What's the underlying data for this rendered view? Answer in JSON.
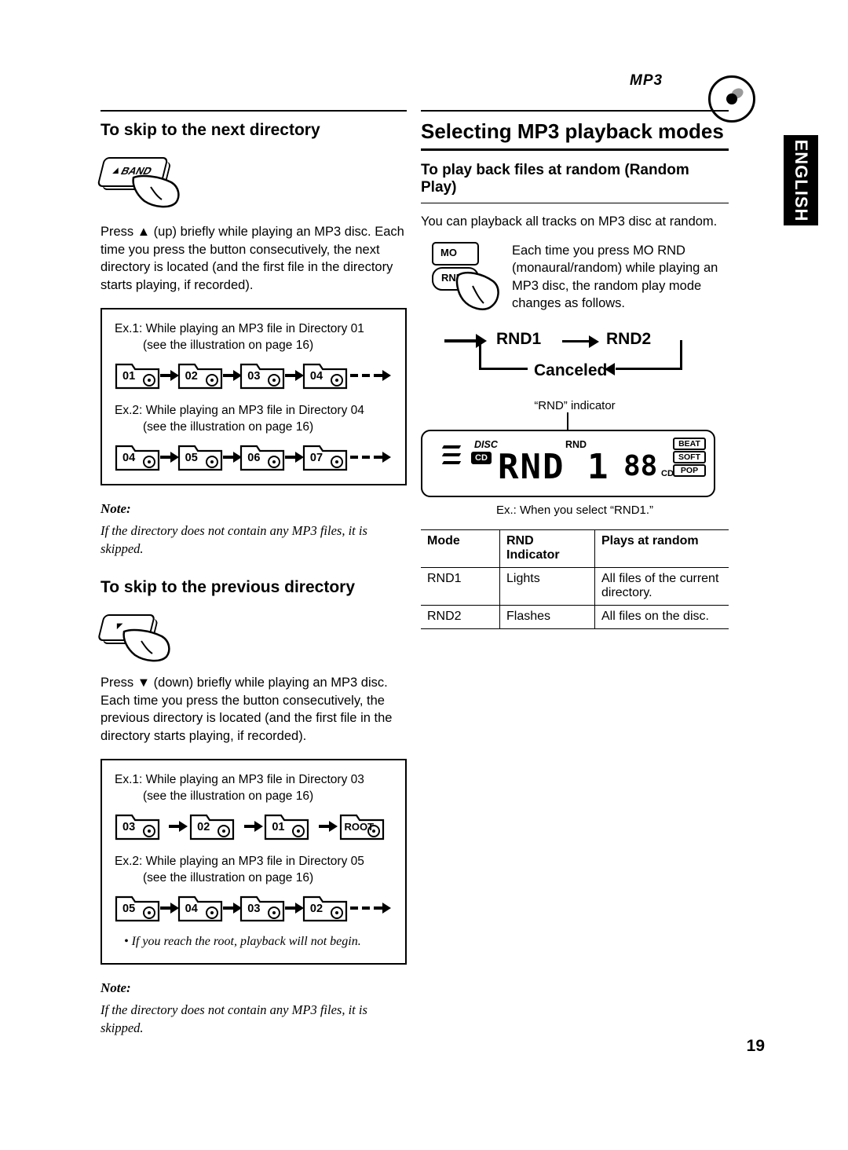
{
  "page": {
    "number": "19",
    "side_tab": "ENGLISH",
    "logo_text": "MP3"
  },
  "left": {
    "heading1": "To skip to the next directory",
    "button1_label": "BAND",
    "paragraph1": "Press ▲ (up) briefly while playing an MP3 disc. Each time you press the button consecutively, the next directory is located (and the first file in the directory starts playing, if recorded).",
    "box1": {
      "ex1_line1": "Ex.1: While playing an MP3 file in Directory 01",
      "ex1_line2": "(see the illustration on page 16)",
      "ex1_folders": [
        "01",
        "02",
        "03",
        "04"
      ],
      "ex2_line1": "Ex.2: While playing an MP3 file in Directory 04",
      "ex2_line2": "(see the illustration on page 16)",
      "ex2_folders": [
        "04",
        "05",
        "06",
        "07"
      ]
    },
    "note1_label": "Note:",
    "note1_text": "If the directory does not contain any MP3 files, it is skipped.",
    "heading2": "To skip to the previous directory",
    "paragraph2": "Press ▼ (down) briefly while playing an MP3 disc. Each time you press the button consecutively, the previous directory is located (and the first file in the directory starts playing, if recorded).",
    "box2": {
      "ex1_line1": "Ex.1: While playing an MP3 file in Directory 03",
      "ex1_line2": "(see the illustration on page 16)",
      "ex1_folders": [
        "03",
        "02",
        "01",
        "ROOT"
      ],
      "ex2_line1": "Ex.2: While playing an MP3 file in Directory 05",
      "ex2_line2": "(see the illustration on page 16)",
      "ex2_folders": [
        "05",
        "04",
        "03",
        "02"
      ],
      "bullet": "•  If you reach the root, playback will not begin."
    },
    "note2_label": "Note:",
    "note2_text": "If the directory does not contain any MP3 files, it is skipped."
  },
  "right": {
    "title": "Selecting MP3 playback modes",
    "subhead": "To play back files at random (Random Play)",
    "intro": "You can playback all tracks on MP3 disc at random.",
    "key_mo": "MO",
    "key_rnd": "RND",
    "key_text": "Each time you press MO RND (monaural/random) while playing an MP3 disc, the random play mode changes as follows.",
    "flow": {
      "step1": "RND1",
      "step2": "RND2",
      "step3": "Canceled"
    },
    "indicator_caption": "“RND” indicator",
    "lcd": {
      "disc": "DISC",
      "cd": "CD",
      "rnd": "RND",
      "main": "RND 1",
      "track": "88",
      "cd_small": "CD",
      "eq": [
        "BEAT",
        "SOFT",
        "POP"
      ]
    },
    "lcd_caption": "Ex.: When you select “RND1.”",
    "table": {
      "headers": [
        "Mode",
        "RND Indicator",
        "Plays at random"
      ],
      "header_col2_line1": "RND",
      "header_col2_line2": "Indicator",
      "rows": [
        {
          "mode": "RND1",
          "indicator": "Lights",
          "plays": "All files of the current directory."
        },
        {
          "mode": "RND2",
          "indicator": "Flashes",
          "plays": "All files on the disc."
        }
      ]
    }
  }
}
